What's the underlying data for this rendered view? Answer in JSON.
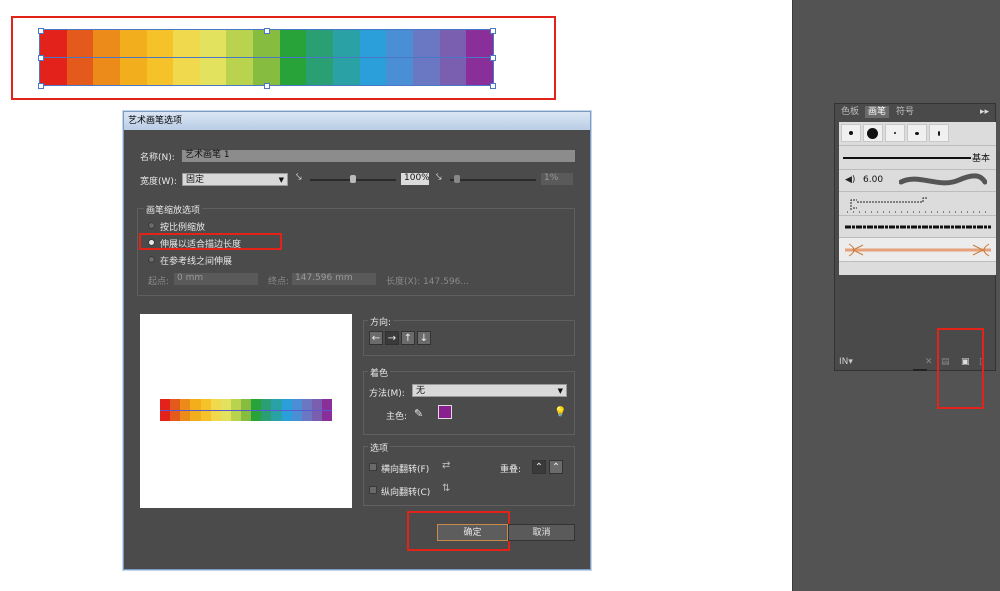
{
  "swatch_colors": [
    "#e3231b",
    "#e45a1c",
    "#ec8a1a",
    "#f2ae1d",
    "#f5c22a",
    "#f0d94c",
    "#e2e25f",
    "#b9d34f",
    "#86bd40",
    "#27a33a",
    "#2a9f73",
    "#2aa1a4",
    "#2a9fda",
    "#4a8fd6",
    "#6a78c4",
    "#7a5fb0",
    "#8a2e9a"
  ],
  "dialog": {
    "title": "艺术画笔选项",
    "name_label": "名称(N):",
    "name_value": "艺术画笔 1",
    "width_label": "宽度(W):",
    "width_value": "固定",
    "width_percent": "100%",
    "variation_value": "1%",
    "scale_group": {
      "title": "画笔缩放选项",
      "opt1": "按比例缩放",
      "opt2": "伸展以适合描边长度",
      "opt3": "在参考线之间伸展",
      "start_label": "起点:",
      "start_value": "0 mm",
      "end_label": "终点:",
      "end_value": "147.596 mm",
      "length_text": "长度(X): 147.596..."
    },
    "direction": {
      "title": "方向:",
      "arrows": [
        "←",
        "→",
        "↑",
        "↓"
      ]
    },
    "colorize": {
      "title": "着色",
      "method_label": "方法(M):",
      "method_value": "无",
      "key_color_label": "主色:",
      "key_color": "#8a1f8e"
    },
    "options": {
      "title": "选项",
      "flip_along": "横向翻转(F)",
      "flip_across": "纵向翻转(C)",
      "overlap_label": "重叠:"
    },
    "ok": "确定",
    "cancel": "取消"
  },
  "panel": {
    "tabs": [
      "色板",
      "画笔",
      "符号"
    ],
    "basic_label": "基本",
    "brush_size": "6.00"
  }
}
